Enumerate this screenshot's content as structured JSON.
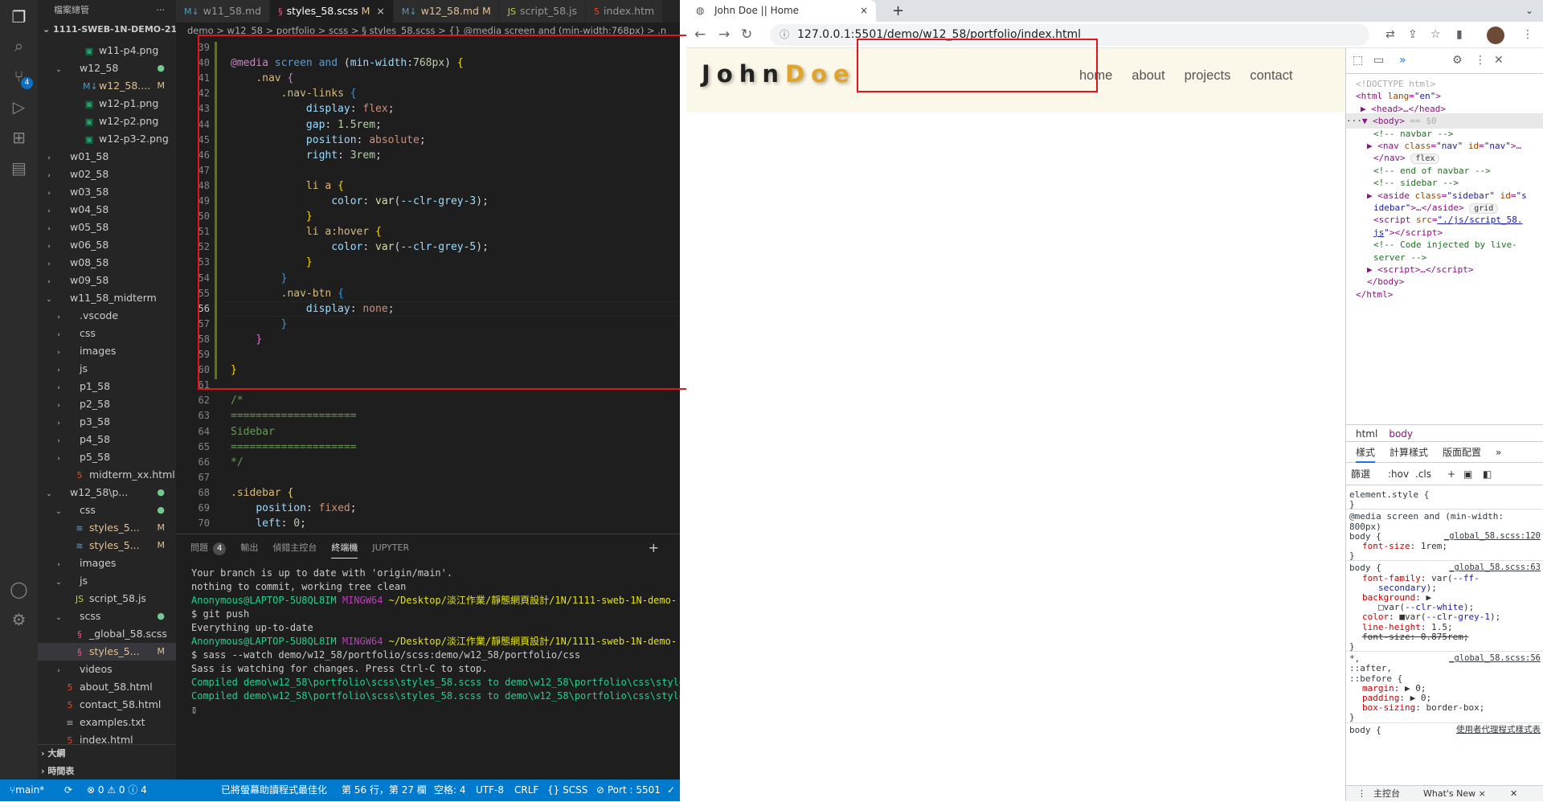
{
  "vscode": {
    "explorer_title": "檔案總管",
    "root": "1111-SWEB-1N-DEMO-211...",
    "tree": [
      {
        "label": "w11-p4.png",
        "indent": 4,
        "chev": "",
        "icon": "png"
      },
      {
        "label": "w12_58",
        "indent": 2,
        "chev": "v",
        "icon": "folder",
        "status": "●"
      },
      {
        "label": "w12_58....",
        "indent": 4,
        "chev": "",
        "icon": "md",
        "status": "M",
        "mod": true
      },
      {
        "label": "w12-p1.png",
        "indent": 4,
        "chev": "",
        "icon": "png"
      },
      {
        "label": "w12-p2.png",
        "indent": 4,
        "chev": "",
        "icon": "png"
      },
      {
        "label": "w12-p3-2.png",
        "indent": 4,
        "chev": "",
        "icon": "png"
      },
      {
        "label": "w01_58",
        "indent": 1,
        "chev": ">",
        "icon": "folder"
      },
      {
        "label": "w02_58",
        "indent": 1,
        "chev": ">",
        "icon": "folder"
      },
      {
        "label": "w03_58",
        "indent": 1,
        "chev": ">",
        "icon": "folder"
      },
      {
        "label": "w04_58",
        "indent": 1,
        "chev": ">",
        "icon": "folder"
      },
      {
        "label": "w05_58",
        "indent": 1,
        "chev": ">",
        "icon": "folder"
      },
      {
        "label": "w06_58",
        "indent": 1,
        "chev": ">",
        "icon": "folder"
      },
      {
        "label": "w08_58",
        "indent": 1,
        "chev": ">",
        "icon": "folder"
      },
      {
        "label": "w09_58",
        "indent": 1,
        "chev": ">",
        "icon": "folder"
      },
      {
        "label": "w11_58_midterm",
        "indent": 1,
        "chev": "v",
        "icon": "folder"
      },
      {
        "label": ".vscode",
        "indent": 2,
        "chev": ">",
        "icon": "folder"
      },
      {
        "label": "css",
        "indent": 2,
        "chev": ">",
        "icon": "folder"
      },
      {
        "label": "images",
        "indent": 2,
        "chev": ">",
        "icon": "folder"
      },
      {
        "label": "js",
        "indent": 2,
        "chev": ">",
        "icon": "folder"
      },
      {
        "label": "p1_58",
        "indent": 2,
        "chev": ">",
        "icon": "folder"
      },
      {
        "label": "p2_58",
        "indent": 2,
        "chev": ">",
        "icon": "folder"
      },
      {
        "label": "p3_58",
        "indent": 2,
        "chev": ">",
        "icon": "folder"
      },
      {
        "label": "p4_58",
        "indent": 2,
        "chev": ">",
        "icon": "folder"
      },
      {
        "label": "p5_58",
        "indent": 2,
        "chev": ">",
        "icon": "folder"
      },
      {
        "label": "midterm_xx.html",
        "indent": 3,
        "chev": "",
        "icon": "html"
      },
      {
        "label": "w12_58\\p...",
        "indent": 1,
        "chev": "v",
        "icon": "folder",
        "status": "●"
      },
      {
        "label": "css",
        "indent": 2,
        "chev": "v",
        "icon": "folder",
        "status": "●"
      },
      {
        "label": "styles_5...",
        "indent": 3,
        "chev": "",
        "icon": "css",
        "status": "M",
        "mod": true
      },
      {
        "label": "styles_5...",
        "indent": 3,
        "chev": "",
        "icon": "css",
        "status": "M",
        "mod": true
      },
      {
        "label": "images",
        "indent": 2,
        "chev": ">",
        "icon": "folder"
      },
      {
        "label": "js",
        "indent": 2,
        "chev": "v",
        "icon": "folder"
      },
      {
        "label": "script_58.js",
        "indent": 3,
        "chev": "",
        "icon": "js"
      },
      {
        "label": "scss",
        "indent": 2,
        "chev": "v",
        "icon": "folder",
        "status": "●"
      },
      {
        "label": "_global_58.scss",
        "indent": 3,
        "chev": "",
        "icon": "scss"
      },
      {
        "label": "styles_5...",
        "indent": 3,
        "chev": "",
        "icon": "scss",
        "status": "M",
        "mod": true,
        "sel": true
      },
      {
        "label": "videos",
        "indent": 2,
        "chev": ">",
        "icon": "folder"
      },
      {
        "label": "about_58.html",
        "indent": 2,
        "chev": "",
        "icon": "html"
      },
      {
        "label": "contact_58.html",
        "indent": 2,
        "chev": "",
        "icon": "html"
      },
      {
        "label": "examples.txt",
        "indent": 2,
        "chev": "",
        "icon": "txt"
      },
      {
        "label": "index.html",
        "indent": 2,
        "chev": "",
        "icon": "html"
      }
    ],
    "outline": "大綱",
    "timeline": "時間表",
    "tabs": [
      {
        "label": "w11_58.md",
        "icon": "M↓",
        "cls": "md"
      },
      {
        "label": "styles_58.scss",
        "icon": "§",
        "cls": "scss",
        "mod": "M",
        "close": "×",
        "active": true
      },
      {
        "label": "w12_58.md",
        "icon": "M↓",
        "cls": "md",
        "mod": "M"
      },
      {
        "label": "script_58.js",
        "icon": "JS",
        "cls": "js"
      },
      {
        "label": "index.htm",
        "icon": "5",
        "cls": "html"
      }
    ],
    "breadcrumb": "demo > w12_58 > portfolio > scss > § styles_58.scss > {} @media screen and (min-width:768px) > .n",
    "code_lines": [
      {
        "n": "39",
        "h": ""
      },
      {
        "n": "40",
        "h": "<span class=k1>@media</span> <span class=k8>screen</span> <span class=k8>and</span> (<span class=k3>min-width</span>:<span class=k5>768px</span>) <span class=b1>{</span>"
      },
      {
        "n": "41",
        "h": "    <span class=k2>.nav</span> <span class=b2>{</span>"
      },
      {
        "n": "42",
        "h": "        <span class=k2>.nav-links</span> <span class=b3>{</span>"
      },
      {
        "n": "43",
        "h": "            <span class=k3>display</span>: <span class=k4>flex</span>;"
      },
      {
        "n": "44",
        "h": "            <span class=k3>gap</span>: <span class=k5>1.5rem</span>;"
      },
      {
        "n": "45",
        "h": "            <span class=k3>position</span>: <span class=k4>absolute</span>;"
      },
      {
        "n": "46",
        "h": "            <span class=k3>right</span>: <span class=k5>3rem</span>;"
      },
      {
        "n": "47",
        "h": ""
      },
      {
        "n": "48",
        "h": "            <span class=k2>li a</span> <span class=b1>{</span>"
      },
      {
        "n": "49",
        "h": "                <span class=k3>color</span>: <span class=k6>var</span>(<span class=k3>--clr-grey-3</span>);"
      },
      {
        "n": "50",
        "h": "            <span class=b1>}</span>"
      },
      {
        "n": "51",
        "h": "            <span class=k2>li a:hover</span> <span class=b1>{</span>"
      },
      {
        "n": "52",
        "h": "                <span class=k3>color</span>: <span class=k6>var</span>(<span class=k3>--clr-grey-5</span>);"
      },
      {
        "n": "53",
        "h": "            <span class=b1>}</span>"
      },
      {
        "n": "54",
        "h": "        <span class=b3>}</span>"
      },
      {
        "n": "55",
        "h": "        <span class=k2>.nav-btn</span> <span class=b3>{</span>"
      },
      {
        "n": "56",
        "h": "            <span class=k3>display</span>: <span class=k4>none</span>;"
      },
      {
        "n": "57",
        "h": "        <span class=b3>}</span>"
      },
      {
        "n": "58",
        "h": "    <span class=b2>}</span>"
      },
      {
        "n": "59",
        "h": ""
      },
      {
        "n": "60",
        "h": "<span class=b1>}</span>"
      },
      {
        "n": "61",
        "h": ""
      },
      {
        "n": "62",
        "h": "<span class=k7>/*</span>"
      },
      {
        "n": "63",
        "h": "<span class=k7>====================</span>"
      },
      {
        "n": "64",
        "h": "<span class=k7>Sidebar</span>"
      },
      {
        "n": "65",
        "h": "<span class=k7>====================</span>"
      },
      {
        "n": "66",
        "h": "<span class=k7>*/</span>"
      },
      {
        "n": "67",
        "h": ""
      },
      {
        "n": "68",
        "h": "<span class=k2>.sidebar</span> <span class=b1>{</span>"
      },
      {
        "n": "69",
        "h": "    <span class=k3>position</span>: <span class=k4>fixed</span>;"
      },
      {
        "n": "70",
        "h": "    <span class=k3>left</span>: <span class=k5>0</span>;"
      }
    ],
    "panel_tabs": [
      "問題",
      "輸出",
      "偵錯主控台",
      "終端機",
      "JUPYTER"
    ],
    "problems_count": "4",
    "terminal": [
      {
        "t": "Your branch is up to date with 'origin/main'.",
        "c": ""
      },
      {
        "t": "",
        "c": ""
      },
      {
        "t": "nothing to commit, working tree clean",
        "c": ""
      },
      {
        "t": "",
        "c": ""
      },
      {
        "t": "Anonymous@LAPTOP-5U8QL8IM MINGW64 ~/Desktop/淡江作業/靜態網頁設計/1N/1111-sweb-1N-demo-",
        "c": "prompt"
      },
      {
        "t": "$ git push",
        "c": ""
      },
      {
        "t": "Everything up-to-date",
        "c": ""
      },
      {
        "t": "",
        "c": ""
      },
      {
        "t": "Anonymous@LAPTOP-5U8QL8IM MINGW64 ~/Desktop/淡江作業/靜態網頁設計/1N/1111-sweb-1N-demo-",
        "c": "prompt"
      },
      {
        "t": "$ sass --watch demo/w12_58/portfolio/scss:demo/w12_58/portfolio/css",
        "c": ""
      },
      {
        "t": "Sass is watching for changes. Press Ctrl-C to stop.",
        "c": ""
      },
      {
        "t": "",
        "c": ""
      },
      {
        "t": "Compiled demo\\w12_58\\portfolio\\scss\\styles_58.scss to demo\\w12_58\\portfolio\\css\\styles_",
        "c": "g"
      },
      {
        "t": "Compiled demo\\w12_58\\portfolio\\scss\\styles_58.scss to demo\\w12_58\\portfolio\\css\\styles_",
        "c": "g"
      }
    ],
    "status": {
      "branch": "main*",
      "sync": "⟳",
      "errors": "⊗ 0 ⚠ 0 ⓘ 4",
      "screen_reader": "已將螢幕助讀程式最佳化",
      "position": "第 56 行，第 27 欄",
      "spaces": "空格: 4",
      "encoding": "UTF-8",
      "eol": "CRLF",
      "lang": "{} SCSS",
      "port": "⊘ Port : 5501",
      "check": "✓"
    }
  },
  "browser": {
    "tab_title": "John Doe || Home",
    "tab_close": "×",
    "new_tab": "+",
    "minimize": "⌄",
    "url": "127.0.0.1:5501/demo/w12_58/portfolio/index.html",
    "brand_first": "John",
    "brand_last": "Doe",
    "nav_links": [
      "home",
      "about",
      "projects",
      "contact"
    ]
  },
  "devtools": {
    "dom": [
      {
        "h": "<span class=dg>&lt;!DOCTYPE html&gt;</span>",
        "x": 12
      },
      {
        "h": "&lt;html <span class=da>lang</span>=<span class=dv>\"en\"</span>&gt;",
        "x": 12
      },
      {
        "h": "▶ &lt;head&gt;…&lt;/head&gt;",
        "x": 18
      },
      {
        "h": "<span style='color:#333'>···</span>▼ &lt;body&gt; <span class=dg>== $0</span>",
        "x": 0,
        "sel": true
      },
      {
        "h": "<span class=dc>&lt;!-- navbar --&gt;</span>",
        "x": 34
      },
      {
        "h": "▶ &lt;nav <span class=da>class</span>=<span class=dv>\"nav\"</span> <span class=da>id</span>=<span class=dv>\"nav\"</span>&gt;…",
        "x": 26
      },
      {
        "h": "&lt;/nav&gt; <span class=dp>flex</span>",
        "x": 34
      },
      {
        "h": "<span class=dc>&lt;!-- end of navbar --&gt;</span>",
        "x": 34
      },
      {
        "h": "<span class=dc>&lt;!-- sidebar --&gt;</span>",
        "x": 34
      },
      {
        "h": "▶ &lt;aside <span class=da>class</span>=<span class=dv>\"sidebar\"</span> <span class=da>id</span>=<span class=dv>\"s</span>",
        "x": 26
      },
      {
        "h": "<span class=dv>idebar\"</span>&gt;…&lt;/aside&gt; <span class=dp>grid</span>",
        "x": 34
      },
      {
        "h": "&lt;script <span class=da>src</span>=<span class=dk>\"./js/script_58.</span>",
        "x": 34
      },
      {
        "h": "<span class=dk>js</span><span class=dv>\"</span>&gt;&lt;/script&gt;",
        "x": 34
      },
      {
        "h": "<span class=dc>&lt;!-- Code injected by live-</span>",
        "x": 34
      },
      {
        "h": "<span class=dc>server --&gt;</span>",
        "x": 34
      },
      {
        "h": "▶ &lt;script&gt;…&lt;/script&gt;",
        "x": 26
      },
      {
        "h": "&lt;/body&gt;",
        "x": 26
      },
      {
        "h": "&lt;/html&gt;",
        "x": 12
      }
    ],
    "crumbs": [
      "html",
      "body"
    ],
    "tabs": [
      "樣式",
      "計算樣式",
      "版面配置",
      "»"
    ],
    "filter": "篩選",
    "hov": ":hov",
    "cls": ".cls",
    "styles": [
      {
        "h": "<span class=sv>element.style {</span>",
        "x": 4
      },
      {
        "h": "<span class=sv>}</span>",
        "x": 4
      },
      {
        "sep": true
      },
      {
        "h": "<span class=sv>@media screen and (min-width:</span>",
        "x": 4
      },
      {
        "h": "<span class=sv>800px)</span>",
        "x": 4
      },
      {
        "h": "<span class=sv>body {</span>",
        "x": 4,
        "file": "_global_58.scss:120"
      },
      {
        "h": "<span class=sp>font-size</span>: 1rem;",
        "x": 20
      },
      {
        "h": "<span class=sv>}</span>",
        "x": 4
      },
      {
        "sep": true
      },
      {
        "h": "<span class=sv>body {</span>",
        "x": 4,
        "file": "_global_58.scss:63"
      },
      {
        "h": "<span class=sp>font-family</span>: var(<span class=dv>--ff-</span>",
        "x": 20
      },
      {
        "h": "<span class=dv>secondary</span>);",
        "x": 40
      },
      {
        "h": "<span class=sp>background</span>: ▶",
        "x": 20
      },
      {
        "h": "□var(<span class=dv>--clr-white</span>);",
        "x": 40
      },
      {
        "h": "<span class=sp>color</span>: ■var(<span class=dv>--clr-grey-1</span>);",
        "x": 20
      },
      {
        "h": "<span class=sp>line-height</span>: 1.5;",
        "x": 20
      },
      {
        "h": "<span class=ss>font-size: 0.875rem;</span>",
        "x": 20
      },
      {
        "h": "<span class=sv>}</span>",
        "x": 4
      },
      {
        "sep": true
      },
      {
        "h": "<span class=sv>*,</span>",
        "x": 4,
        "file": "_global_58.scss:56"
      },
      {
        "h": "<span class=sv>::after,</span>",
        "x": 4
      },
      {
        "h": "<span class=sv>::before {</span>",
        "x": 4
      },
      {
        "h": "<span class=sp>margin</span>: ▶ 0;",
        "x": 20
      },
      {
        "h": "<span class=sp>padding</span>: ▶ 0;",
        "x": 20
      },
      {
        "h": "<span class=sp>box-sizing</span>: border-box;",
        "x": 20
      },
      {
        "h": "<span class=sv>}</span>",
        "x": 4
      },
      {
        "sep": true
      },
      {
        "h": "<span class=sv>body {</span>",
        "x": 4,
        "file": "使用者代理程式樣式表"
      }
    ],
    "drawer_console": "主控台",
    "drawer_whatsnew": "What's New ×"
  }
}
